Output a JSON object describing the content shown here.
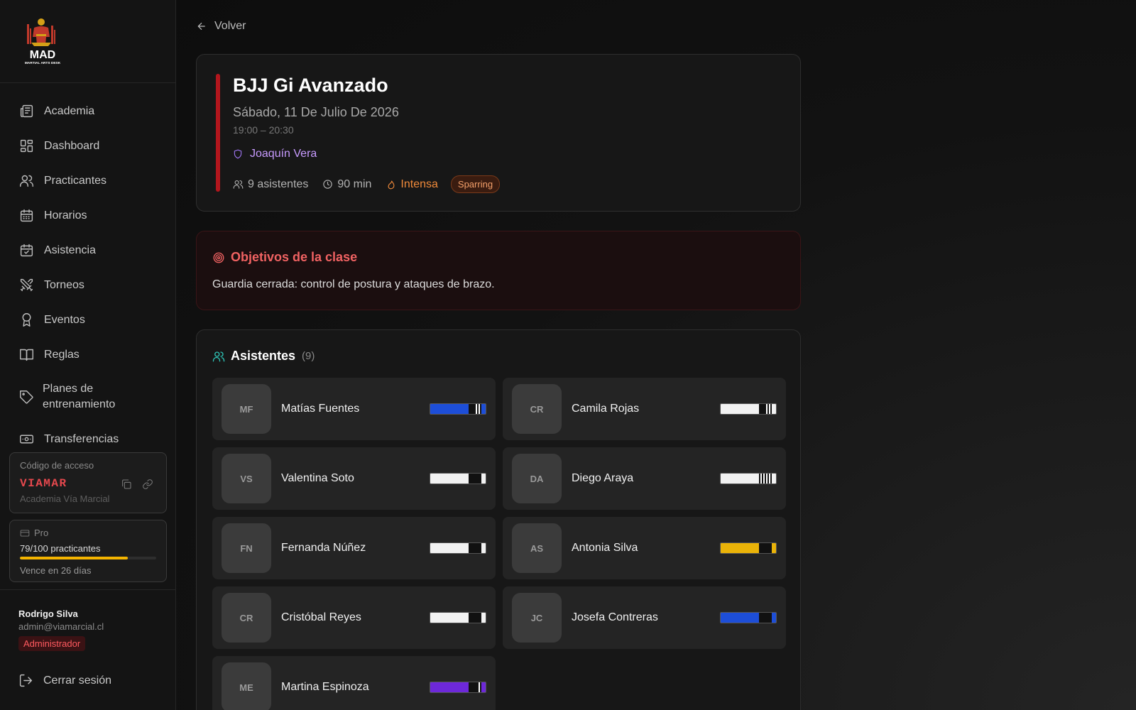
{
  "brand": {
    "name": "MAD",
    "tagline": "MARTIAL ARTS DESK"
  },
  "sidebar": {
    "items": [
      {
        "label": "Academia",
        "icon": "newspaper-icon"
      },
      {
        "label": "Dashboard",
        "icon": "dashboard-icon"
      },
      {
        "label": "Practicantes",
        "icon": "users-icon"
      },
      {
        "label": "Horarios",
        "icon": "calendar-grid-icon"
      },
      {
        "label": "Asistencia",
        "icon": "calendar-check-icon"
      },
      {
        "label": "Torneos",
        "icon": "crossed-swords-icon"
      },
      {
        "label": "Eventos",
        "icon": "award-icon"
      },
      {
        "label": "Reglas",
        "icon": "book-icon"
      },
      {
        "label": "Planes de entrenamiento",
        "icon": "tag-icon"
      },
      {
        "label": "Transferencias",
        "icon": "banknote-icon"
      }
    ],
    "access": {
      "title": "Código de acceso",
      "code": "VIAMAR",
      "academy": "Academia Vía Marcial"
    },
    "plan": {
      "name": "Pro",
      "count": "79/100 practicantes",
      "usage": 0.79,
      "expires": "Vence en 26 días",
      "bar_color": "#f4b400"
    },
    "user": {
      "name": "Rodrigo Silva",
      "email": "admin@viamarcial.cl",
      "role": "Administrador"
    },
    "logout": "Cerrar sesión"
  },
  "main": {
    "back": "Volver",
    "class": {
      "title": "BJJ Gi Avanzado",
      "date": "Sábado, 11 De Julio De 2026",
      "time": "19:00 – 20:30",
      "instructor": "Joaquín Vera",
      "attendees": "9 asistentes",
      "duration": "90 min",
      "intensity": "Intensa",
      "tag": "Sparring",
      "accent": "#b3161d"
    },
    "objectives": {
      "title": "Objetivos de la clase",
      "text": "Guardia cerrada: control de postura y ataques de brazo."
    },
    "attendees": {
      "title": "Asistentes",
      "count": "(9)",
      "list": [
        {
          "initials": "MF",
          "name": "Matías Fuentes",
          "belt": "#1d4ed8",
          "stripes": 2
        },
        {
          "initials": "CR",
          "name": "Camila Rojas",
          "belt": "#f2f2f2",
          "stripes": 2
        },
        {
          "initials": "VS",
          "name": "Valentina Soto",
          "belt": "#f2f2f2",
          "stripes": 0
        },
        {
          "initials": "DA",
          "name": "Diego Araya",
          "belt": "#f2f2f2",
          "stripes": 4
        },
        {
          "initials": "FN",
          "name": "Fernanda Núñez",
          "belt": "#f2f2f2",
          "stripes": 0
        },
        {
          "initials": "AS",
          "name": "Antonia Silva",
          "belt": "#eab308",
          "stripes": 0
        },
        {
          "initials": "CR",
          "name": "Cristóbal Reyes",
          "belt": "#f2f2f2",
          "stripes": 0
        },
        {
          "initials": "JC",
          "name": "Josefa Contreras",
          "belt": "#1d4ed8",
          "stripes": 0
        },
        {
          "initials": "ME",
          "name": "Martina Espinoza",
          "belt": "#6d28d9",
          "stripes": 1
        }
      ]
    }
  }
}
